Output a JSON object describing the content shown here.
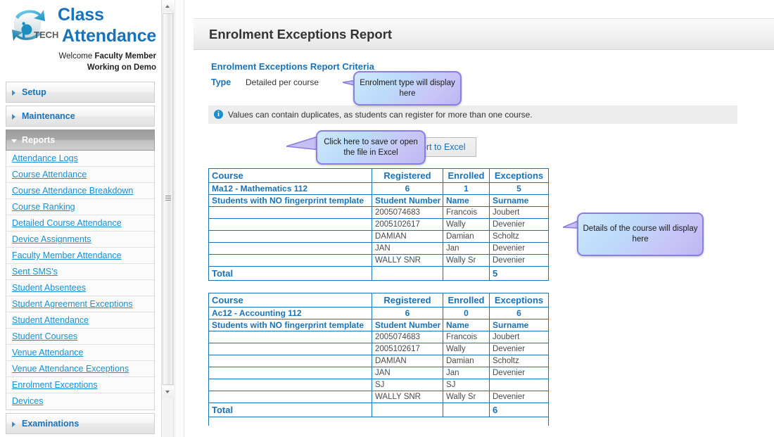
{
  "brand": {
    "logo_icon": "iptech-globe-logo",
    "title_line1": "Class",
    "title_line2": "Attendance",
    "welcome_line1_prefix": "Welcome ",
    "welcome_role": "Faculty Member",
    "welcome_line2": "Working on Demo"
  },
  "sidebar": {
    "sections": [
      {
        "label": "Setup",
        "state": "collapsed",
        "icon": "chevron-right-icon"
      },
      {
        "label": "Maintenance",
        "state": "collapsed",
        "icon": "chevron-right-icon"
      },
      {
        "label": "Reports",
        "state": "expanded",
        "icon": "chevron-down-icon"
      },
      {
        "label": "Examinations",
        "state": "collapsed",
        "icon": "chevron-right-icon"
      }
    ],
    "report_links": [
      "Attendance Logs",
      "Course Attendance",
      "Course Attendance Breakdown",
      "Course Ranking",
      "Detailed Course Attendance",
      "Device Assignments",
      "Faculty Member Attendance",
      "Sent SMS's",
      "Student Absentees",
      "Student Agreement Exceptions",
      "Student Attendance",
      "Student Courses",
      "Venue Attendance",
      "Venue Attendance Exceptions",
      "Enrolment Exceptions",
      "Devices"
    ]
  },
  "scrollbar": {
    "up_icon": "scroll-up-arrow-icon",
    "down_icon": "scroll-down-arrow-icon",
    "grip_icon": "scrollbar-grip-icon"
  },
  "page": {
    "title": "Enrolment Exceptions Report",
    "criteria_heading": "Enrolment Exceptions Report Criteria",
    "type_label": "Type",
    "type_value": "Detailed per course",
    "info_icon": "info-icon",
    "info_message": "Values can contain duplicates, as students can register for more than one course.",
    "export_label": "Export to Excel"
  },
  "callouts": [
    {
      "name": "type-callout",
      "text": "Enrolment type will display here"
    },
    {
      "name": "export-callout",
      "text": "Click here to save or open the file in Excel"
    },
    {
      "name": "details-callout",
      "text": "Details of the course will display here"
    }
  ],
  "tables": [
    {
      "headers": [
        "Course",
        "Registered",
        "Enrolled",
        "Exceptions"
      ],
      "course": {
        "name": "Ma12 - Mathematics 112",
        "registered": "6",
        "enrolled": "1",
        "exceptions": "5"
      },
      "sub_headers": [
        "Students with NO fingerprint template",
        "Student Number",
        "Name",
        "Surname"
      ],
      "students": [
        {
          "number": "2005074683",
          "name": "Francois",
          "surname": "Joubert"
        },
        {
          "number": "2005102617",
          "name": "Wally",
          "surname": "Devenier"
        },
        {
          "number": "DAMIAN",
          "name": "Damian",
          "surname": "Scholtz"
        },
        {
          "number": "JAN",
          "name": "Jan",
          "surname": "Devenier"
        },
        {
          "number": "WALLY SNR",
          "name": "Wally Sr",
          "surname": "Devenier"
        }
      ],
      "total_label": "Total",
      "total_value": "5"
    },
    {
      "headers": [
        "Course",
        "Registered",
        "Enrolled",
        "Exceptions"
      ],
      "course": {
        "name": "Ac12 - Accounting 112",
        "registered": "6",
        "enrolled": "0",
        "exceptions": "6"
      },
      "sub_headers": [
        "Students with NO fingerprint template",
        "Student Number",
        "Name",
        "Surname"
      ],
      "students": [
        {
          "number": "2005074683",
          "name": "Francois",
          "surname": "Joubert"
        },
        {
          "number": "2005102617",
          "name": "Wally",
          "surname": "Devenier"
        },
        {
          "number": "DAMIAN",
          "name": "Damian",
          "surname": "Scholtz"
        },
        {
          "number": "JAN",
          "name": "Jan",
          "surname": "Devenier"
        },
        {
          "number": "SJ",
          "name": "SJ",
          "surname": ""
        },
        {
          "number": "WALLY SNR",
          "name": "Wally Sr",
          "surname": "Devenier"
        }
      ],
      "total_label": "Total",
      "total_value": "6"
    }
  ],
  "colors": {
    "brand_blue": "#1a72b8",
    "link_blue": "#1a8fd6",
    "callout_border": "#8a7fe0",
    "info_bg": "#ededed",
    "table_border": "#1a72b8"
  }
}
